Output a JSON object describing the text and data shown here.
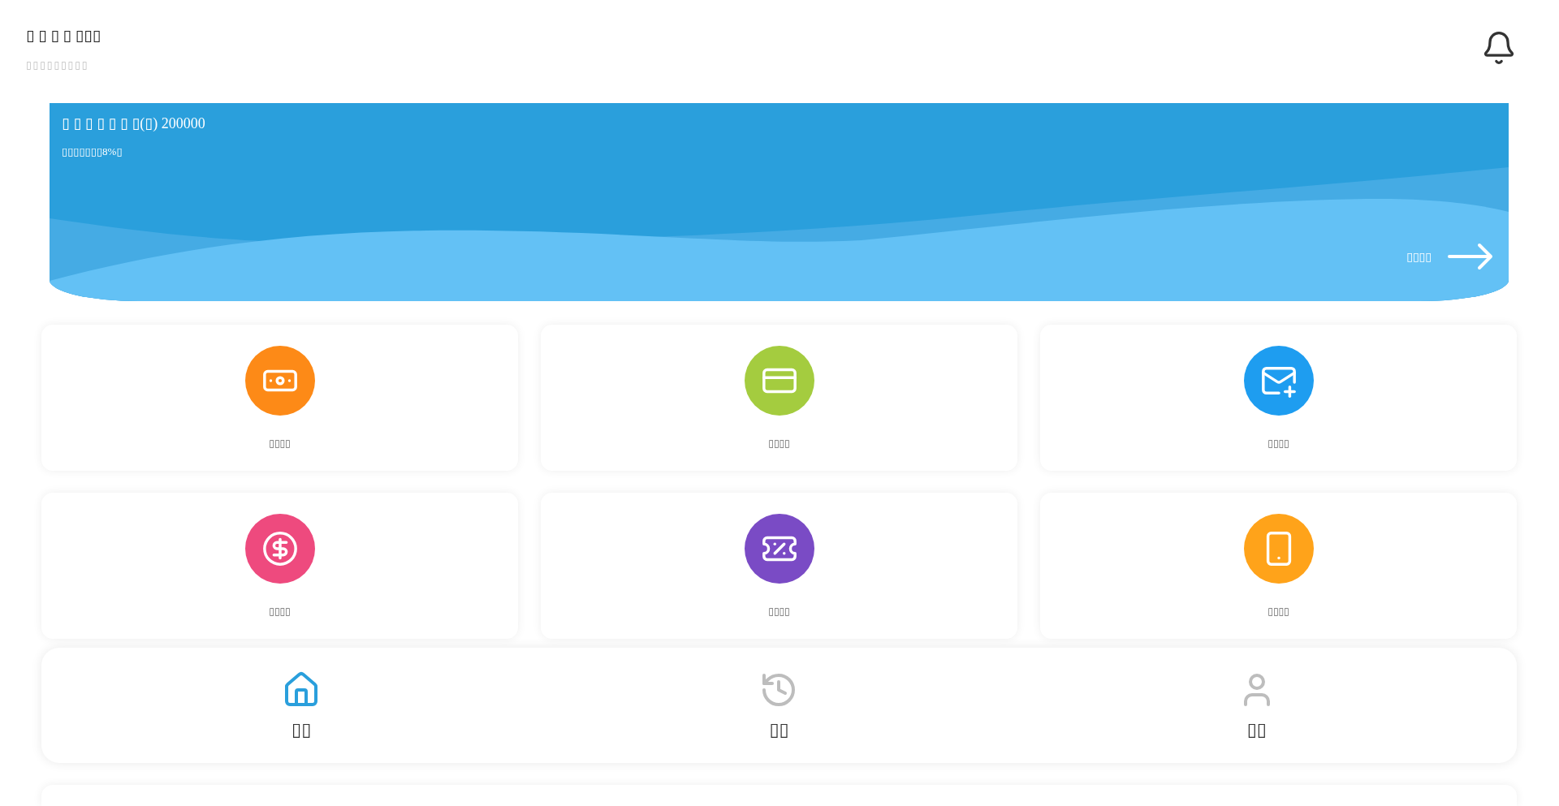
{
  "header": {
    "title": "▯ ▯ ▯ ▯ ▯▯▯",
    "subtitle": "▯▯▯▯▯▯▯▯▯"
  },
  "banner": {
    "title": "▯ ▯ ▯ ▯ ▯ ▯ ▯(▯) 200000",
    "subtitle": "▯▯▯▯▯▯▯8%▯",
    "link": "▯▯▯▯"
  },
  "cards": [
    {
      "label": "▯▯▯▯",
      "color": "#fd8a17"
    },
    {
      "label": "▯▯▯▯",
      "color": "#a4cc3f"
    },
    {
      "label": "▯▯▯▯",
      "color": "#1e9df0"
    },
    {
      "label": "▯▯▯▯",
      "color": "#ee4a7e"
    },
    {
      "label": "▯▯▯▯",
      "color": "#7a4bc5"
    },
    {
      "label": "▯▯▯▯",
      "color": "#ffa31a"
    }
  ],
  "nav": {
    "items": [
      {
        "label": "▯▯",
        "selected": true
      },
      {
        "label": "▯▯",
        "selected": false
      },
      {
        "label": "▯▯",
        "selected": false
      }
    ]
  }
}
